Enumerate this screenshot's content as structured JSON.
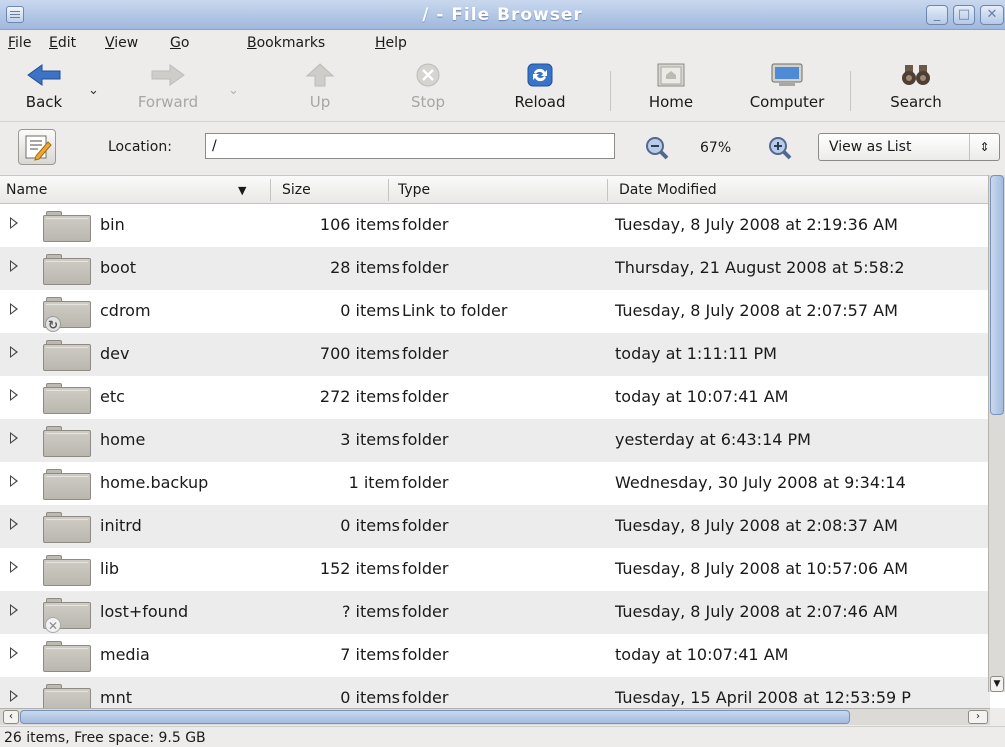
{
  "window": {
    "title": "/ - File Browser"
  },
  "menu": [
    {
      "pre": "",
      "u": "F",
      "post": "ile"
    },
    {
      "pre": "",
      "u": "E",
      "post": "dit"
    },
    {
      "pre": "",
      "u": "V",
      "post": "iew"
    },
    {
      "pre": "",
      "u": "G",
      "post": "o"
    },
    {
      "pre": "",
      "u": "B",
      "post": "ookmarks"
    },
    {
      "pre": "",
      "u": "H",
      "post": "elp"
    }
  ],
  "toolbar": {
    "back": "Back",
    "forward": "Forward",
    "up": "Up",
    "stop": "Stop",
    "reload": "Reload",
    "home": "Home",
    "computer": "Computer",
    "search": "Search"
  },
  "location": {
    "label": "Location:",
    "value": "/"
  },
  "zoom": {
    "level": "67%"
  },
  "view": {
    "selected": "View as List"
  },
  "columns": {
    "name": "Name",
    "size": "Size",
    "type": "Type",
    "date": "Date Modified"
  },
  "rows": [
    {
      "name": "bin",
      "size": "106 items",
      "type": "folder",
      "date": "Tuesday, 8 July 2008 at 2:19:36 AM",
      "badge": ""
    },
    {
      "name": "boot",
      "size": "28 items",
      "type": "folder",
      "date": "Thursday, 21 August 2008 at 5:58:2",
      "badge": ""
    },
    {
      "name": "cdrom",
      "size": "0 items",
      "type": "Link to folder",
      "date": "Tuesday, 8 July 2008 at 2:07:57 AM",
      "badge": "link"
    },
    {
      "name": "dev",
      "size": "700 items",
      "type": "folder",
      "date": "today at 1:11:11 PM",
      "badge": ""
    },
    {
      "name": "etc",
      "size": "272 items",
      "type": "folder",
      "date": "today at 10:07:41 AM",
      "badge": ""
    },
    {
      "name": "home",
      "size": "3 items",
      "type": "folder",
      "date": "yesterday at 6:43:14 PM",
      "badge": ""
    },
    {
      "name": "home.backup",
      "size": "1 item",
      "type": "folder",
      "date": "Wednesday, 30 July 2008 at 9:34:14",
      "badge": ""
    },
    {
      "name": "initrd",
      "size": "0 items",
      "type": "folder",
      "date": "Tuesday, 8 July 2008 at 2:08:37 AM",
      "badge": ""
    },
    {
      "name": "lib",
      "size": "152 items",
      "type": "folder",
      "date": "Tuesday, 8 July 2008 at 10:57:06 AM",
      "badge": ""
    },
    {
      "name": "lost+found",
      "size": "? items",
      "type": "folder",
      "date": "Tuesday, 8 July 2008 at 2:07:46 AM",
      "badge": "x"
    },
    {
      "name": "media",
      "size": "7 items",
      "type": "folder",
      "date": "today at 10:07:41 AM",
      "badge": ""
    },
    {
      "name": "mnt",
      "size": "0 items",
      "type": "folder",
      "date": "Tuesday, 15 April 2008 at 12:53:59 P",
      "badge": ""
    }
  ],
  "status": "26 items, Free space: 9.5 GB"
}
